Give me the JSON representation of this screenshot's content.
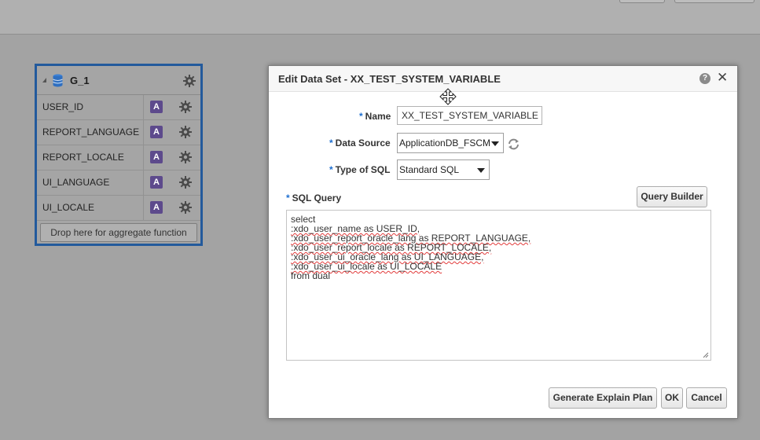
{
  "group": {
    "title": "G_1",
    "columns": [
      {
        "label": "USER_ID",
        "type_badge": "A"
      },
      {
        "label": "REPORT_LANGUAGE",
        "type_badge": "A"
      },
      {
        "label": "REPORT_LOCALE",
        "type_badge": "A"
      },
      {
        "label": "UI_LANGUAGE",
        "type_badge": "A"
      },
      {
        "label": "UI_LOCALE",
        "type_badge": "A"
      }
    ],
    "aggregate_drop_text": "Drop here for aggregate function"
  },
  "dialog": {
    "title": "Edit Data Set - XX_TEST_SYSTEM_VARIABLE",
    "help_label": "?",
    "close_label": "✕",
    "required_marker": "*",
    "name_label": "Name",
    "name_value": "XX_TEST_SYSTEM_VARIABLE",
    "data_source_label": "Data Source",
    "data_source_value": "ApplicationDB_FSCM",
    "sql_type_label": "Type of SQL",
    "sql_type_value": "Standard SQL",
    "sql_query_label": "SQL Query",
    "query_builder_label": "Query Builder",
    "sql_lines": [
      "select",
      ":xdo_user_name as USER_ID,",
      ":xdo_user_report_oracle_lang as REPORT_LANGUAGE,",
      ":xdo_user_report_locale as REPORT_LOCALE,",
      ":xdo_user_ui_oracle_lang as UI_LANGUAGE,",
      ":xdo_user_ui_locale as UI_LOCALE",
      "from dual"
    ],
    "buttons": {
      "explain": "Generate Explain Plan",
      "ok": "OK",
      "cancel": "Cancel"
    }
  },
  "colors": {
    "group_border": "#235a9c",
    "attr_badge": "#5d4a8c",
    "required_star": "#1e6fd0",
    "spell_error": "#e23b3b"
  }
}
